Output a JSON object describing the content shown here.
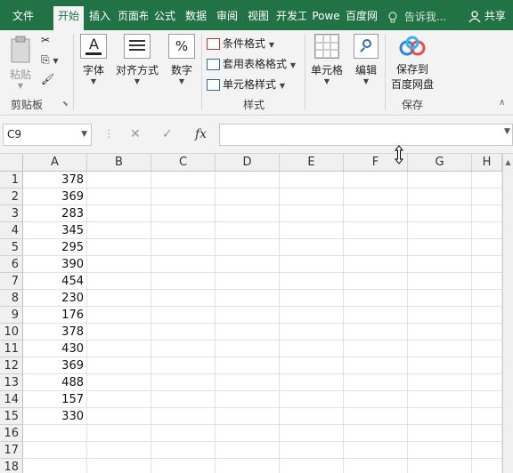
{
  "tabs": [
    {
      "label": "文件",
      "active": false
    },
    {
      "label": "开始",
      "active": true
    },
    {
      "label": "插入",
      "active": false
    },
    {
      "label": "页面布",
      "active": false
    },
    {
      "label": "公式",
      "active": false
    },
    {
      "label": "数据",
      "active": false
    },
    {
      "label": "审阅",
      "active": false
    },
    {
      "label": "视图",
      "active": false
    },
    {
      "label": "开发工",
      "active": false
    },
    {
      "label": "Powe",
      "active": false
    },
    {
      "label": "百度网",
      "active": false
    }
  ],
  "tell_me": "告诉我...",
  "share": "共享",
  "ribbon": {
    "paste": "粘贴",
    "clipboard_group": "剪贴板",
    "font": "字体",
    "alignment": "对齐方式",
    "number": "数字",
    "number_symbol": "%",
    "conditional_format": "条件格式",
    "table_format": "套用表格格式",
    "cell_style": "单元格样式",
    "styles_group": "样式",
    "cells": "单元格",
    "editing": "编辑",
    "save_line1": "保存到",
    "save_line2": "百度网盘",
    "save_group": "保存"
  },
  "formula_bar": {
    "name_box": "C9",
    "cancel": "✕",
    "confirm": "✓",
    "fx": "fx",
    "value": ""
  },
  "columns": [
    "A",
    "B",
    "C",
    "D",
    "E",
    "F",
    "G",
    "H"
  ],
  "rows": [
    {
      "num": "1",
      "a": "378"
    },
    {
      "num": "2",
      "a": "369"
    },
    {
      "num": "3",
      "a": "283"
    },
    {
      "num": "4",
      "a": "345"
    },
    {
      "num": "5",
      "a": "295"
    },
    {
      "num": "6",
      "a": "390"
    },
    {
      "num": "7",
      "a": "454"
    },
    {
      "num": "8",
      "a": "230"
    },
    {
      "num": "9",
      "a": "176"
    },
    {
      "num": "10",
      "a": "378"
    },
    {
      "num": "11",
      "a": "430"
    },
    {
      "num": "12",
      "a": "369"
    },
    {
      "num": "13",
      "a": "488"
    },
    {
      "num": "14",
      "a": "157"
    },
    {
      "num": "15",
      "a": "330"
    },
    {
      "num": "16",
      "a": ""
    },
    {
      "num": "17",
      "a": ""
    },
    {
      "num": "18",
      "a": ""
    }
  ],
  "colors": {
    "accent": "#217346"
  }
}
